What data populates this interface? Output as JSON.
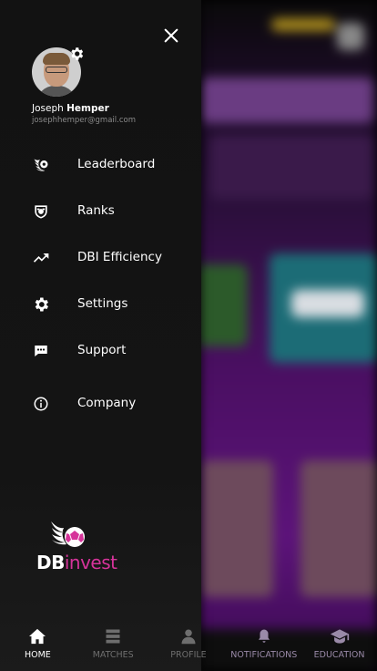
{
  "drawer": {
    "user": {
      "first_name": "Joseph",
      "last_name": "Hemper",
      "email": "josephhemper@gmail.com"
    },
    "menu": [
      {
        "label": "Leaderboard",
        "icon": "soccer-wings-icon"
      },
      {
        "label": "Ranks",
        "icon": "ranks-badge-icon"
      },
      {
        "label": "DBI Efficiency",
        "icon": "trending-up-icon"
      },
      {
        "label": "Settings",
        "icon": "gear-icon"
      },
      {
        "label": "Support",
        "icon": "chat-bubble-icon"
      },
      {
        "label": "Company",
        "icon": "info-icon"
      }
    ],
    "logo": {
      "part1": "DB",
      "part2": "invest"
    }
  },
  "bottom_nav": [
    {
      "label": "HOME",
      "icon": "home-icon",
      "active": true
    },
    {
      "label": "MATCHES",
      "icon": "matches-icon",
      "active": false
    },
    {
      "label": "PROFILE",
      "icon": "profile-icon",
      "active": false
    },
    {
      "label": "NOTIFICATIONS",
      "icon": "bell-icon",
      "active": false
    },
    {
      "label": "EDUCATION",
      "icon": "graduation-cap-icon",
      "active": false
    }
  ],
  "colors": {
    "accent": "#d6339a",
    "drawer_bg": "#141414",
    "background": "#4a0f62"
  }
}
